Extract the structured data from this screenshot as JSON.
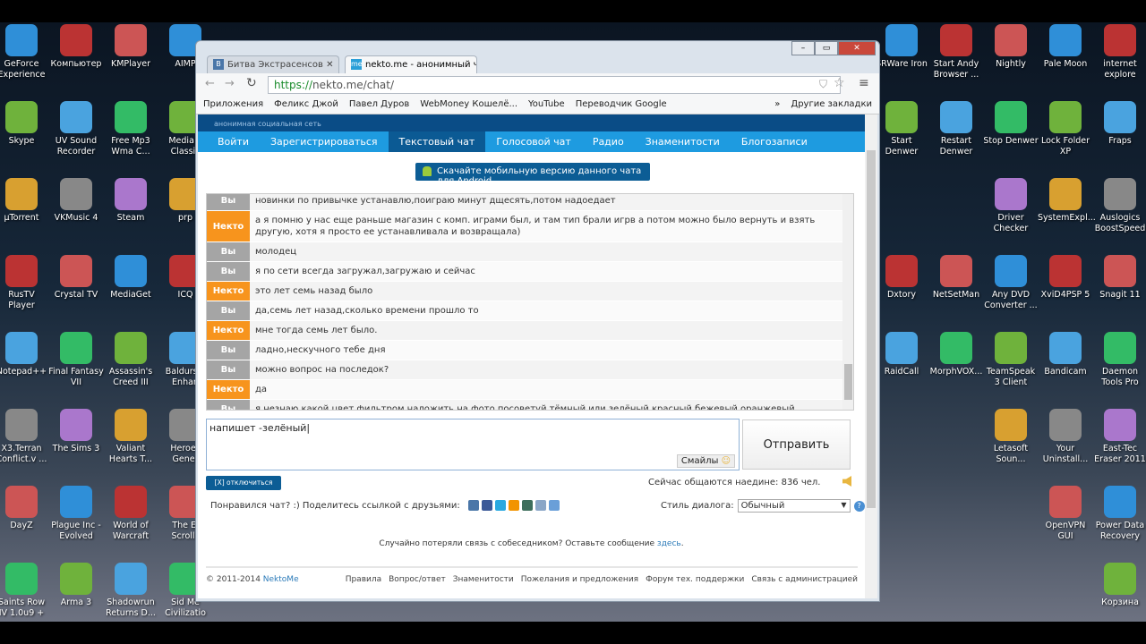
{
  "desktop": {
    "left_columns": [
      [
        "GeForce Experience",
        "Skype",
        "µTorrent",
        "RusTV Player",
        "Notepad++",
        "X3.Terran Conflict.v ...",
        "DayZ",
        "Saints Row IV 1.0u9 + ..."
      ],
      [
        "Компьютер",
        "UV Sound Recorder",
        "VKMusic 4",
        "Crystal TV",
        "Final Fantasy VII",
        "The Sims 3",
        "Plague Inc - Evolved",
        "Arma 3"
      ],
      [
        "KMPlayer",
        "Free Mp3 Wma C...",
        "Steam",
        "MediaGet",
        "Assassin's Creed III",
        "Valiant Hearts T...",
        "World of Warcraft",
        "Shadowrun Returns D..."
      ],
      [
        "AIMP",
        "Media P Classic",
        "prp",
        "ICQ",
        "Baldurs II Enhan",
        "Heroes Gener",
        "The El Scrolls",
        "Sid Me Civilizatio"
      ]
    ],
    "right_columns": [
      [
        "SRWare Iron",
        "Start Denwer",
        null,
        "Dxtory",
        "RaidCall",
        null,
        null,
        null
      ],
      [
        "Start Andy Browser ...",
        "Restart Denwer",
        null,
        "NetSetMan",
        "MorphVOX...",
        null,
        null,
        null
      ],
      [
        "Nightly",
        "Stop Denwer",
        "Driver Checker",
        "Any DVD Converter ...",
        "TeamSpeak 3 Client",
        "Letasoft Soun...",
        null,
        null
      ],
      [
        "Pale Moon",
        "Lock Folder XP",
        "SystemExpl...",
        "XviD4PSP 5",
        "Bandicam",
        "Your Uninstall...",
        "OpenVPN GUI",
        null
      ],
      [
        "internet explore",
        "Fraps",
        "Auslogics BoostSpeed",
        "Snagit 11",
        "Daemon Tools Pro",
        "East-Tec Eraser 2011",
        "Power Data Recovery",
        "Корзина"
      ]
    ]
  },
  "browser": {
    "tabs": [
      {
        "label": "Битва Экстрасенсов",
        "favicon": "В"
      },
      {
        "label": "nekto.me - анонимный ч",
        "favicon": "me"
      }
    ],
    "url_scheme": "https://",
    "url_rest": "nekto.me/chat/",
    "bookmarks": [
      "Приложения",
      "Феликс Джой",
      "Павел Дуров",
      "WebMoney Кошелё...",
      "YouTube",
      "Переводчик Google"
    ],
    "more": "»",
    "other_bookmarks": "Другие закладки"
  },
  "site": {
    "tagline": "анонимная социальная сеть",
    "nav": [
      "Войти",
      "Зарегистрироваться",
      "Текстовый чат",
      "Голосовой чат",
      "Радио",
      "Знаменитости",
      "Блогозаписи"
    ],
    "active_nav": 2,
    "android_banner": "Скачайте мобильную версию данного чата для Android",
    "messages": [
      {
        "who": "Вы",
        "text": "новинки по привычке устанавлю,поиграю минут дщесять,потом надоедает"
      },
      {
        "who": "Некто",
        "text": "а я помню у нас еще раньше магазин с комп. играми был, и там тип брали игрв а потом можно было вернуть и взять другую, хотя я просто ее устанавливала и возвращала)"
      },
      {
        "who": "Вы",
        "text": "молодец"
      },
      {
        "who": "Вы",
        "text": "я по сети всегда загружал,загружаю и сейчас"
      },
      {
        "who": "Некто",
        "text": "это лет семь назад было"
      },
      {
        "who": "Вы",
        "text": "да,семь лет назад,сколько времени прошло то"
      },
      {
        "who": "Некто",
        "text": "мне тогда семь лет было."
      },
      {
        "who": "Вы",
        "text": "ладно,нескучного тебе дня"
      },
      {
        "who": "Вы",
        "text": "можно вопрос на последок?"
      },
      {
        "who": "Некто",
        "text": "да"
      },
      {
        "who": "Вы",
        "text": "я незнаю какой цвет фильтром наложить на фото,посоветуй тёмный или зелёный,красный,бежевый,оранжевый"
      }
    ],
    "input_value": "напишет -зелёный",
    "smiles_label": "Смайлы",
    "send_label": "Отправить",
    "disconnect_label": "[X] отключиться",
    "online_text": "Сейчас общаются наедине: 836 чел.",
    "share_text": "Понравился чат? :) Поделитесь ссылкой с друзьями:",
    "style_label": "Стиль диалога:",
    "style_value": "Обычный",
    "lost_text": "Случайно потеряли связь с собеседником? Оставьте сообщение ",
    "lost_link": "здесь",
    "copyright": "© 2011-2014 ",
    "copyright_link": "NektoMe",
    "footer_links": [
      "Правила",
      "Вопрос/ответ",
      "Знаменитости",
      "Пожелания и предложения",
      "Форум тех. поддержки",
      "Связь с администрацией"
    ]
  },
  "colors": {
    "you": "#a5a5a5",
    "nekto": "#f7941d",
    "nav": "#1e9be0",
    "header": "#0a4c86"
  }
}
